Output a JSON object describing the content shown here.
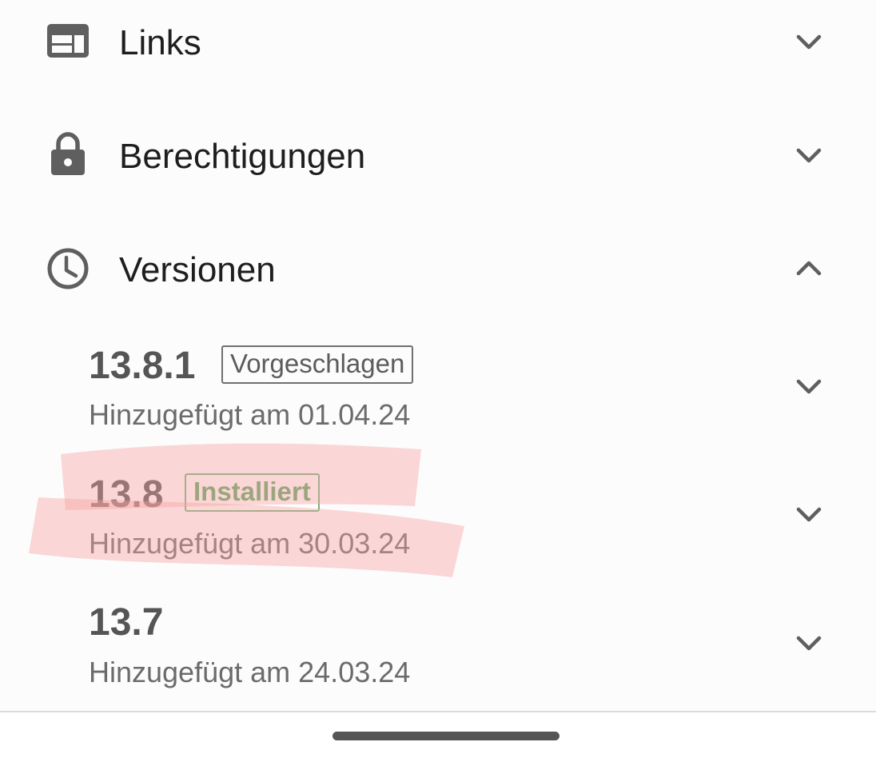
{
  "sections": [
    {
      "label": "Links",
      "icon": "web-panel-icon",
      "state": "collapsed"
    },
    {
      "label": "Berechtigungen",
      "icon": "lock-icon",
      "state": "collapsed"
    },
    {
      "label": "Versionen",
      "icon": "clock-icon",
      "state": "expanded"
    }
  ],
  "versions": [
    {
      "number": "13.8.1",
      "badge": "Vorgeschlagen",
      "date": "Hinzugefügt am 01.04.24"
    },
    {
      "number": "13.8",
      "badge": "Installiert",
      "date": "Hinzugefügt am 30.03.24"
    },
    {
      "number": "13.7",
      "badge": "",
      "date": "Hinzugefügt am 24.03.24"
    }
  ],
  "colors": {
    "background": "#fcfcfc",
    "icon": "#5f5f5f",
    "installed_badge": "#5aa865",
    "highlight": "#f8a0a0"
  }
}
